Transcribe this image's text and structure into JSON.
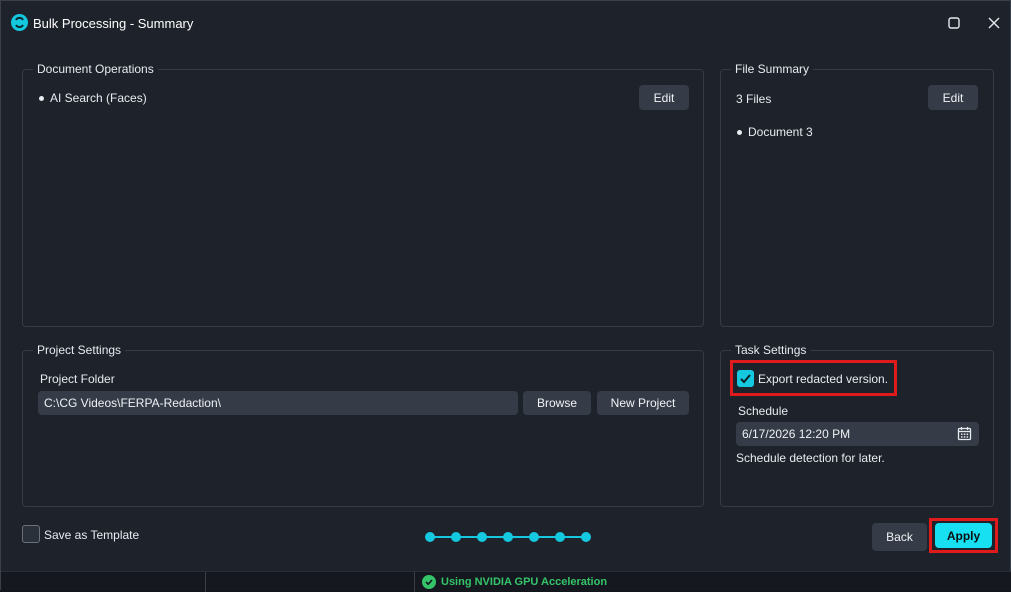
{
  "window": {
    "title": "Bulk Processing - Summary",
    "icons": {
      "app": "app-logo-icon",
      "maximize": "maximize-icon",
      "close": "close-icon"
    }
  },
  "document_operations": {
    "title": "Document Operations",
    "items": [
      "AI Search (Faces)"
    ],
    "edit_label": "Edit"
  },
  "file_summary": {
    "title": "File Summary",
    "count": "3 Files",
    "items": [
      "Document 3"
    ],
    "edit_label": "Edit"
  },
  "project_settings": {
    "title": "Project Settings",
    "folder_label": "Project Folder",
    "folder_value": "C:\\CG Videos\\FERPA-Redaction\\",
    "browse_label": "Browse",
    "new_project_label": "New Project"
  },
  "task_settings": {
    "title": "Task Settings",
    "export_label": "Export redacted version.",
    "export_checked": true,
    "schedule_label": "Schedule",
    "schedule_value": "6/17/2026 12:20 PM",
    "schedule_hint": "Schedule detection for later.",
    "calendar_icon": "calendar-icon"
  },
  "footer": {
    "save_template_label": "Save as Template",
    "save_template_checked": false,
    "steps_total": 7,
    "back_label": "Back",
    "apply_label": "Apply"
  },
  "status_bar": {
    "gpu_text": "Using NVIDIA GPU Acceleration",
    "gpu_icon": "check-circle-icon"
  },
  "colors": {
    "accent": "#14c8e0",
    "highlight": "#e01b1b",
    "status_ok": "#35c46a",
    "background": "#1e232b"
  }
}
